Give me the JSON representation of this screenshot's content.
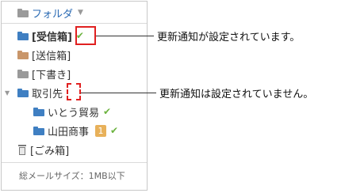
{
  "folder_header": {
    "label": "フォルダ"
  },
  "folders": {
    "inbox": "[受信箱]",
    "sent": "[送信箱]",
    "drafts": "[下書き]",
    "clients": "取引先",
    "client_1": "いとう貿易",
    "client_2": "山田商事",
    "client_2_badge": "1",
    "trash": "[ごみ箱]"
  },
  "footer": {
    "total_size": "総メールサイズ：1MB以下"
  },
  "callouts": {
    "enabled": "更新通知が設定されています。",
    "disabled": "更新通知は設定されていません。"
  },
  "colors": {
    "highlight": "#e02020",
    "check": "#6cb33f",
    "folder_blue": "#3f7fc2",
    "badge": "#e8b15a"
  }
}
